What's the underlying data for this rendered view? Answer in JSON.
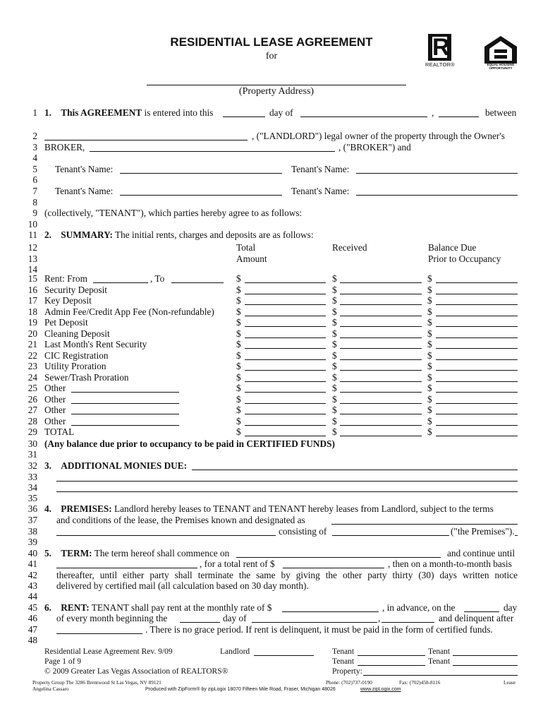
{
  "header": {
    "title": "RESIDENTIAL LEASE AGREEMENT",
    "for": "for",
    "property_address_label": "(Property Address)",
    "logos": {
      "realtor_label": "REALTOR®",
      "realtor_icon": "realtor-r-icon",
      "eho_label_1": "EQUAL HOUSING",
      "eho_label_2": "OPPORTUNITY",
      "eho_icon": "equal-housing-house-icon"
    }
  },
  "line_numbers": [
    "1",
    "2",
    "3",
    "4",
    "5",
    "6",
    "7",
    "8",
    "9",
    "10",
    "11",
    "12",
    "13",
    "14",
    "15",
    "16",
    "17",
    "18",
    "19",
    "20",
    "21",
    "22",
    "23",
    "24",
    "25",
    "26",
    "27",
    "28",
    "29",
    "30",
    "31",
    "32",
    "33",
    "34",
    "35",
    "36",
    "37",
    "38",
    "39",
    "40",
    "41",
    "42",
    "43",
    "44",
    "45",
    "46",
    "47",
    "48"
  ],
  "section1": {
    "num": "1.",
    "bold": "This AGREEMENT",
    "t1": "is entered into this",
    "t2": "day of",
    "t3": ",",
    "t4": "between",
    "landlord_text": ", (\"LANDLORD\") legal owner of the property through the Owner's",
    "broker_label": "BROKER,",
    "broker_text": ", (\"BROKER\") and",
    "tenant_name_label": "Tenant's Name:",
    "collectively": "(collectively, \"TENANT\"), which parties hereby agree to as follows:"
  },
  "section2": {
    "num": "2.",
    "bold": "SUMMARY:",
    "text": "The initial rents, charges and deposits are as follows:",
    "col_headers": {
      "total_1": "Total",
      "total_2": "Amount",
      "received": "Received",
      "balance_1": "Balance Due",
      "balance_2": "Prior to Occupancy"
    },
    "currency": "$",
    "rent_from": "Rent: From",
    "rent_to": ", To",
    "rows": [
      "Security Deposit",
      "Key Deposit",
      "Admin Fee/Credit App Fee (Non-refundable)",
      "Pet Deposit",
      "Cleaning Deposit",
      "Last Month's Rent Security",
      "CIC Registration",
      "Utility Proration",
      "Sewer/Trash Proration",
      "Other",
      "Other",
      "Other",
      "Other",
      "TOTAL"
    ],
    "note": "(Any balance due prior to occupancy to be paid in CERTIFIED FUNDS)"
  },
  "section3": {
    "num": "3.",
    "bold": "ADDITIONAL MONIES DUE:"
  },
  "section4": {
    "num": "4.",
    "bold": "PREMISES:",
    "line1": "Landlord hereby leases to TENANT and TENANT hereby leases from Landlord, subject to the terms",
    "line2": "and conditions of the lease, the Premises known and designated as",
    "consisting_of": "consisting of",
    "the_premises": "(\"the Premises\")."
  },
  "section5": {
    "num": "5.",
    "bold": "TERM:",
    "t1": "The term hereof shall commence on",
    "t2": "and continue until",
    "t3": ", for a total rent of $",
    "t4": ", then on a month-to-month basis",
    "line3": "thereafter, until either party shall terminate the same by giving the other party thirty (30) days written notice",
    "line4": "delivered by certified mail (all calculation based on 30 day month)."
  },
  "section6": {
    "num": "6.",
    "bold": "RENT:",
    "t1": "TENANT shall pay rent at the monthly rate of $",
    "t2": ", in advance, on the",
    "t3": "day",
    "t4": "of every month beginning the",
    "t5": "day of",
    "t6": ",",
    "t7": "and delinquent after",
    "t8": ". There is no grace period. If rent is delinquent, it must be paid in the form of certified funds."
  },
  "footer": {
    "rev": "Residential Lease Agreement Rev. 9/09",
    "page": "Page 1 of 9",
    "copyright": "© 2009 Greater Las Vegas Association of REALTORS®",
    "landlord": "Landlord",
    "tenant": "Tenant",
    "property": "Property:",
    "office": "Property Group The 3286 Brentwood St Las Vegas, NV 89121",
    "agent": "Angelina Cassaro",
    "phone": "Phone: (702)737-0190",
    "fax": "Fax:  (702)458-8116",
    "doc_name": "Lease",
    "produced": "Produced with ZipForm® by zipLogix  18070 Fifteen Mile Road, Fraser, Michigan 48026",
    "website": "www.zipLogix.com"
  }
}
